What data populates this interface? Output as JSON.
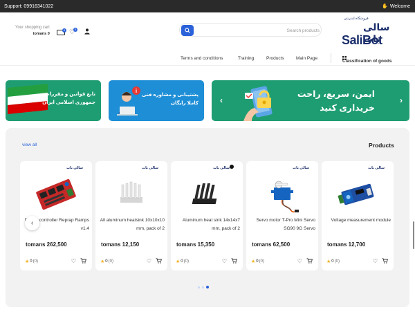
{
  "topbar": {
    "support": "Support: 09916341022",
    "welcome": "Welcome"
  },
  "header": {
    "cart_label": "Your shopping cart",
    "cart_total": "tomans 0",
    "compare_count": "0",
    "wishlist_count": "0",
    "search_placeholder": "Search products",
    "logo_fa_small": "فروشگاه اینترنتی",
    "logo_fa": "سالی بات",
    "logo_en": "SaliBot"
  },
  "nav": {
    "items": [
      "Terms and conditions",
      "Training",
      "Products",
      "Main Page"
    ],
    "category": "Classification of goods"
  },
  "banners": {
    "laws": "تابع قوانین و مقررات\nجمهوری اسلامی ایران",
    "support": "پشتیبانی و مشاوره فنی\nکاملا رایگان",
    "safe": "ایمن، سریع، راحت\nخریداری کنید"
  },
  "products": {
    "title": "Products",
    "view_all": "view all",
    "items": [
      {
        "name": "Printer controller Reprap Ramps v1.4",
        "price": "tomans 262,500",
        "rating": "0",
        "count": "(0)",
        "icon": "ramps-board-image"
      },
      {
        "name": "All aluminum heatsink 10x10x10 mm, pack of 2",
        "price": "tomans 12,150",
        "rating": "0",
        "count": "(0)",
        "icon": "aluminum-heatsink-image"
      },
      {
        "name": "Aluminum heat sink 14x14x7 mm, pack of 2",
        "price": "tomans 15,350",
        "rating": "0",
        "count": "(0)",
        "icon": "black-heatsink-image"
      },
      {
        "name": "Servo motor T-Pro Mini Servo SG90 9G Servo",
        "price": "tomans 62,500",
        "rating": "0",
        "count": "(0)",
        "icon": "servo-motor-image"
      },
      {
        "name": "Voltage measurement module",
        "price": "tomans 12,700",
        "rating": "0",
        "count": "(0)",
        "icon": "voltage-module-image"
      }
    ],
    "mini_logo": "سالی بات"
  },
  "colors": {
    "accent": "#2b62d9",
    "banner_green": "#1f9d72",
    "banner_blue": "#1e8ed6",
    "topbar": "#2a2a2a"
  }
}
